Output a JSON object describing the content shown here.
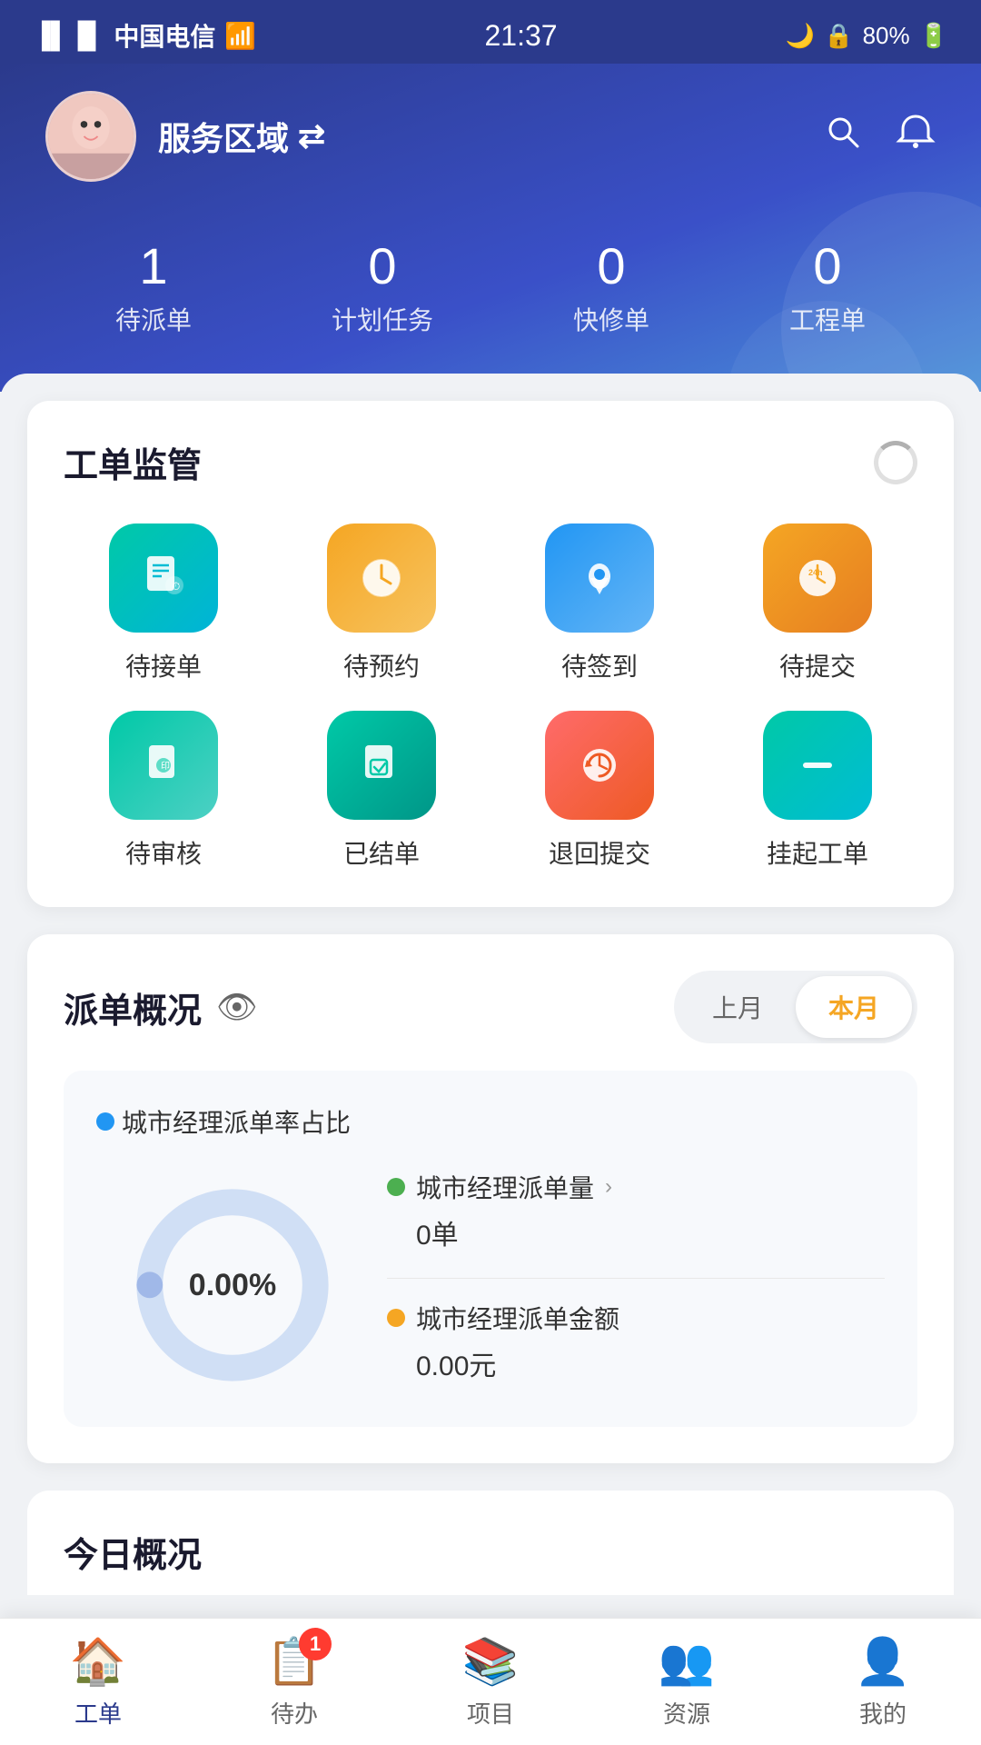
{
  "statusBar": {
    "carrier": "中国电信",
    "time": "21:37",
    "battery": "80%"
  },
  "header": {
    "avatarEmoji": "👩",
    "serviceArea": "服务区域",
    "switchIcon": "⇄",
    "searchIcon": "🔍",
    "bellIcon": "🔔"
  },
  "stats": [
    {
      "number": "1",
      "label": "待派单"
    },
    {
      "number": "0",
      "label": "计划任务"
    },
    {
      "number": "0",
      "label": "快修单"
    },
    {
      "number": "0",
      "label": "工程单"
    }
  ],
  "workOrderSection": {
    "title": "工单监管",
    "items": [
      {
        "label": "待接单",
        "iconClass": "icon-teal",
        "icon": "📋"
      },
      {
        "label": "待预约",
        "iconClass": "icon-orange",
        "icon": "🕐"
      },
      {
        "label": "待签到",
        "iconClass": "icon-blue",
        "icon": "📍"
      },
      {
        "label": "待提交",
        "iconClass": "icon-gold",
        "icon": "⏱"
      },
      {
        "label": "待审核",
        "iconClass": "icon-teal2",
        "icon": "📄"
      },
      {
        "label": "已结单",
        "iconClass": "icon-teal3",
        "icon": "✅"
      },
      {
        "label": "退回提交",
        "iconClass": "icon-red",
        "icon": "↩"
      },
      {
        "label": "挂起工单",
        "iconClass": "icon-cyan",
        "icon": "➖"
      }
    ]
  },
  "dispatchSection": {
    "title": "派单概况",
    "eyeIcon": "👁",
    "tabs": [
      "上月",
      "本月"
    ],
    "activeTab": "本月",
    "donutValue": "0.00%",
    "legend": [
      {
        "color": "dot-blue",
        "label": "城市经理派单率占比"
      }
    ],
    "stats": [
      {
        "dotColor": "dot-green",
        "label": "城市经理派单量",
        "hasLink": true,
        "value": "0单"
      },
      {
        "dotColor": "dot-orange",
        "label": "城市经理派单金额",
        "hasLink": false,
        "value": "0.00元"
      }
    ]
  },
  "partialSection": {
    "title": "今日概况"
  },
  "bottomNav": [
    {
      "icon": "🏠",
      "label": "工单",
      "active": true,
      "badge": null
    },
    {
      "icon": "📋",
      "label": "待办",
      "active": false,
      "badge": "1"
    },
    {
      "icon": "📚",
      "label": "项目",
      "active": false,
      "badge": null
    },
    {
      "icon": "👥",
      "label": "资源",
      "active": false,
      "badge": null
    },
    {
      "icon": "👤",
      "label": "我的",
      "active": false,
      "badge": null
    }
  ]
}
